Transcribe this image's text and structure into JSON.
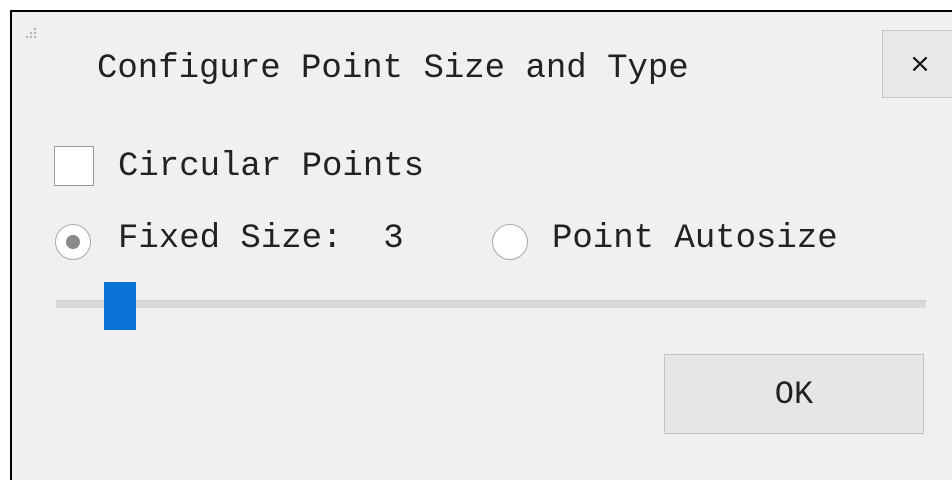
{
  "dialog": {
    "title": "Configure Point Size and Type",
    "close_label": "×"
  },
  "options": {
    "circular_points": {
      "label": "Circular Points",
      "checked": false
    },
    "fixed_size": {
      "label": "Fixed Size:",
      "value": "3",
      "selected": true
    },
    "point_autosize": {
      "label": "Point Autosize",
      "selected": false
    }
  },
  "slider": {
    "value": 3
  },
  "buttons": {
    "ok_label": "OK"
  },
  "colors": {
    "accent": "#0a74d8",
    "background": "#f0f0f0"
  },
  "icons": {
    "grip": "drag-grip-icon",
    "close": "close-icon"
  }
}
